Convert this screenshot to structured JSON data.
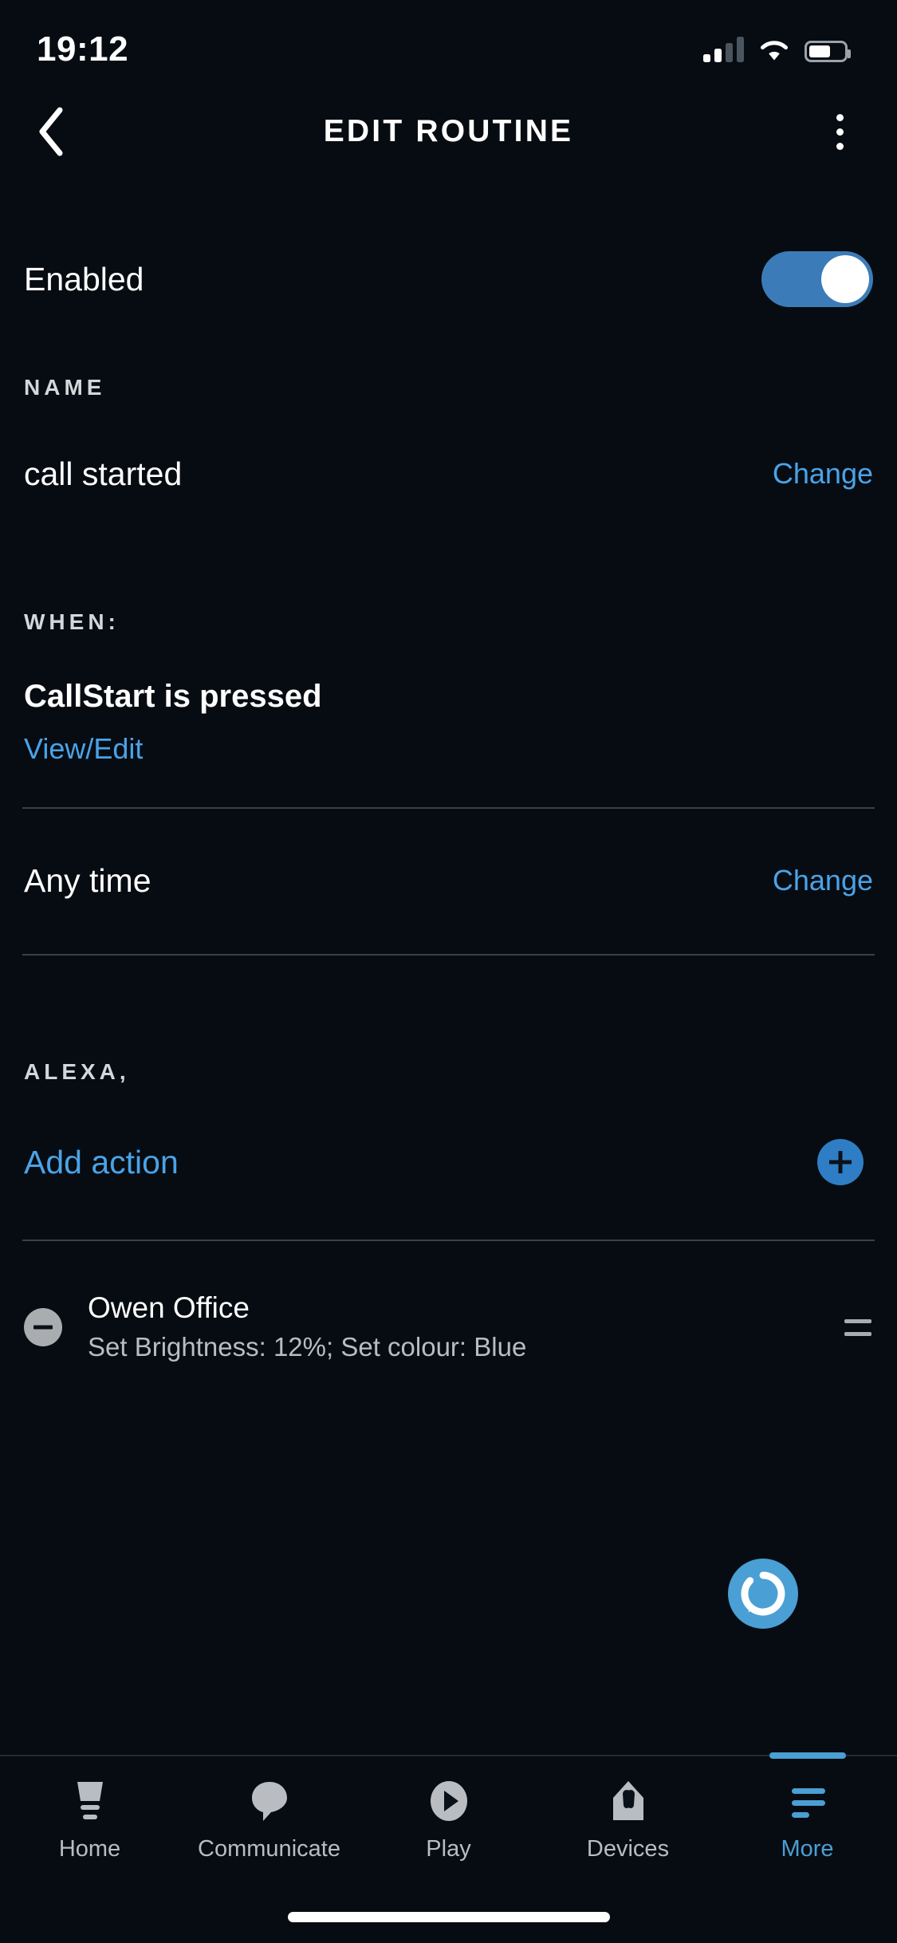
{
  "status_bar": {
    "time": "19:12",
    "signal_icon": "cellular-signal-icon",
    "signal_bars_filled": 2,
    "signal_bars_total": 4,
    "wifi_icon": "wifi-icon",
    "battery_icon": "battery-icon",
    "battery_level_percent": 62
  },
  "header": {
    "back_icon": "chevron-left-icon",
    "title": "EDIT ROUTINE",
    "menu_icon": "overflow-menu-icon"
  },
  "enabled": {
    "label": "Enabled",
    "toggle_on": true,
    "accent": "#3b7cb8"
  },
  "name_section": {
    "label": "NAME",
    "value": "call started",
    "change_label": "Change"
  },
  "when_section": {
    "label": "WHEN:",
    "trigger": "CallStart is pressed",
    "view_edit_label": "View/Edit",
    "time_value": "Any time",
    "time_change_label": "Change"
  },
  "alexa_section": {
    "label": "ALEXA,",
    "add_action_label": "Add action",
    "add_icon": "plus-circle-icon",
    "actions": [
      {
        "remove_icon": "minus-circle-icon",
        "title": "Owen Office",
        "subtitle": "Set Brightness: 12%; Set colour: Blue",
        "drag_icon": "drag-handle-icon"
      }
    ]
  },
  "alexa_fab": {
    "icon": "alexa-ring-icon",
    "color": "#4a9fd4"
  },
  "tab_bar": {
    "active_index": 4,
    "accent": "#4a9fd4",
    "tabs": [
      {
        "label": "Home",
        "icon": "home-icon"
      },
      {
        "label": "Communicate",
        "icon": "speech-bubble-icon"
      },
      {
        "label": "Play",
        "icon": "play-circle-icon"
      },
      {
        "label": "Devices",
        "icon": "devices-house-icon"
      },
      {
        "label": "More",
        "icon": "more-lines-icon"
      }
    ]
  },
  "link_color": "#4aa3e8"
}
